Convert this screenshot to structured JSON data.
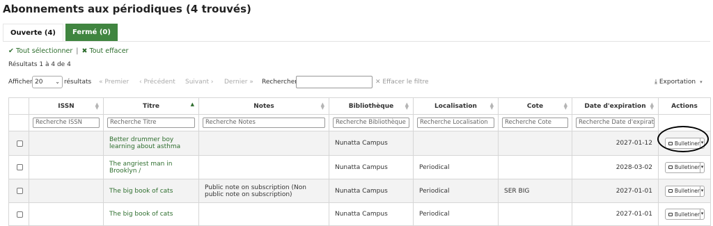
{
  "page": {
    "title": "Abonnements aux périodiques (4 trouvés)"
  },
  "tabs": [
    {
      "label": "Ouverte (4)",
      "active": true
    },
    {
      "label": "Fermé (0)",
      "active": false
    }
  ],
  "selection": {
    "select_all": "Tout sélectionner",
    "separator": "|",
    "clear_all": "Tout effacer"
  },
  "results_info": "Résultats 1 à 4 de 4",
  "toolbar": {
    "show_label": "Afficher",
    "page_size": "20",
    "results_label": "résultats",
    "first": "Premier",
    "previous": "Précédent",
    "next": "Suivant",
    "last": "Dernier",
    "search_label": "Rechercher :",
    "clear_filter": "Effacer le filtre",
    "export": "Exportation"
  },
  "table": {
    "columns": [
      {
        "label": "",
        "sort": "none"
      },
      {
        "label": "ISSN",
        "sort": "none"
      },
      {
        "label": "Titre",
        "sort": "asc"
      },
      {
        "label": "Notes",
        "sort": "none"
      },
      {
        "label": "Bibliothèque",
        "sort": "none"
      },
      {
        "label": "Localisation",
        "sort": "none"
      },
      {
        "label": "Cote",
        "sort": "none"
      },
      {
        "label": "Date d'expiration",
        "sort": "none"
      },
      {
        "label": "Actions",
        "sort": "none"
      }
    ],
    "filter_placeholders": {
      "issn": "Recherche ISSN",
      "title": "Recherche Titre",
      "notes": "Recherche Notes",
      "library": "Recherche Bibliothèque",
      "location": "Recherche Localisation",
      "callnumber": "Recherche Cote",
      "expiration": "Recherche Date d'expiration"
    },
    "action_label": "Bulletiner",
    "rows": [
      {
        "issn": "",
        "title": "Better drummer boy learning about asthma",
        "notes": "",
        "library": "Nunatta Campus",
        "location": "",
        "callnumber": "",
        "expiration": "2027-01-12"
      },
      {
        "issn": "",
        "title": "The angriest man in Brooklyn /",
        "notes": "",
        "library": "Nunatta Campus",
        "location": "Periodical",
        "callnumber": "",
        "expiration": "2028-03-02"
      },
      {
        "issn": "",
        "title": "The big book of cats",
        "notes": "Public note on subscription (Non public note on subscription)",
        "library": "Nunatta Campus",
        "location": "Periodical",
        "callnumber": "SER BIG",
        "expiration": "2027-01-01"
      },
      {
        "issn": "",
        "title": "The big book of cats",
        "notes": "",
        "library": "Nunatta Campus",
        "location": "Periodical",
        "callnumber": "",
        "expiration": "2027-01-01"
      }
    ]
  },
  "colors": {
    "accent": "#408540",
    "link": "#2e6e2e",
    "row_alt": "#f3f3f3"
  }
}
